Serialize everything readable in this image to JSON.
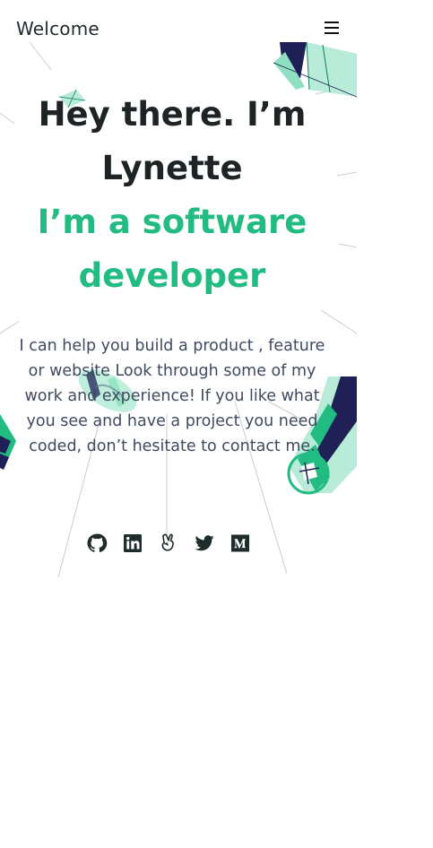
{
  "header": {
    "title": "Welcome",
    "menu_icon": "hamburger-menu-icon"
  },
  "hero": {
    "greeting": "Hey there. I’m Lynette",
    "role": "I’m a software developer",
    "intro": "I can help you build a product , feature or website Look through some of my work and experience! If you like what you see and have a project you need coded, don’t hesitate to contact me."
  },
  "social": [
    {
      "name": "GitHub",
      "icon": "github-icon"
    },
    {
      "name": "LinkedIn",
      "icon": "linkedin-icon"
    },
    {
      "name": "AngelList",
      "icon": "angellist-icon"
    },
    {
      "name": "Twitter",
      "icon": "twitter-icon"
    },
    {
      "name": "Medium",
      "icon": "medium-icon"
    }
  ],
  "colors": {
    "text_dark": "#1e2326",
    "accent_green": "#22bc83",
    "mint": "#b8ecd8",
    "navy": "#1f2156",
    "body_text": "#3f4a60"
  }
}
